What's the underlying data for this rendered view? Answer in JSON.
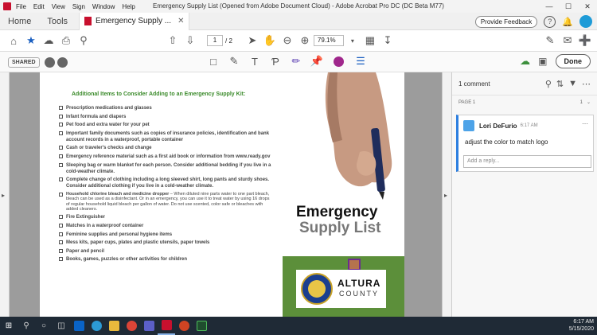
{
  "titlebar": {
    "menus": [
      "File",
      "Edit",
      "View",
      "Sign",
      "Window",
      "Help"
    ],
    "window_title": "Emergency Supply List (Opened from Adobe Document Cloud) - Adobe Acrobat Pro DC (DC Beta M77)"
  },
  "tabbar": {
    "home": "Home",
    "tools": "Tools",
    "doc_tab": "Emergency Supply ...",
    "feedback": "Provide Feedback",
    "help": "?"
  },
  "toolbar": {
    "page_current": "1",
    "page_total": "/ 2",
    "zoom": "79.1%"
  },
  "commentbar": {
    "shared": "SHARED",
    "done": "Done",
    "accent_color": "#a0278c"
  },
  "document": {
    "heading": "Additional Items to Consider Adding to an Emergency Supply Kit:",
    "items": [
      "Prescription medications and glasses",
      "Infant formula and diapers",
      "Pet food and extra water for your pet",
      "Important family documents such as copies of insurance policies, identification and bank account records in a waterproof, portable container",
      "Cash or traveler's checks and change",
      "Emergency reference material such as a first aid book or information from www.ready.gov",
      "Sleeping bag or warm blanket for each person. Consider additional bedding if you live in a cold-weather climate.",
      "Complete change of clothing including a long sleeved shirt, long pants and sturdy shoes. Consider additional clothing if you live in a cold-weather climate."
    ],
    "chlorine_label": "Household chlorine bleach and medicine dropper",
    "chlorine_note": " – When diluted nine parts water to one part bleach, bleach can be used as a disinfectant. Or in an emergency, you can use it to treat water by using 16 drops of regular household liquid bleach per gallon of water. Do not use scented, color safe or bleaches with added cleaners.",
    "items2": [
      "Fire Extinguisher",
      "Matches in a waterproof container",
      "Feminine supplies and personal hygiene items",
      "Mess kits, paper cups, plates and plastic utensils, paper towels",
      "Paper and pencil",
      "Books, games, puzzles or other activities for children"
    ],
    "title_line1": "Emergency",
    "title_line2": "Supply List",
    "logo_name": "ALTURA",
    "logo_sub": "COUNTY"
  },
  "comments": {
    "count": "1 comment",
    "page_label": "PAGE 1",
    "page_count": "1",
    "author": "Lori DeFurio",
    "time": "6:17 AM",
    "text": "adjust the color to match logo",
    "reply_placeholder": "Add a reply..."
  },
  "taskbar": {
    "time": "6:17 AM",
    "date": "5/15/2020"
  }
}
